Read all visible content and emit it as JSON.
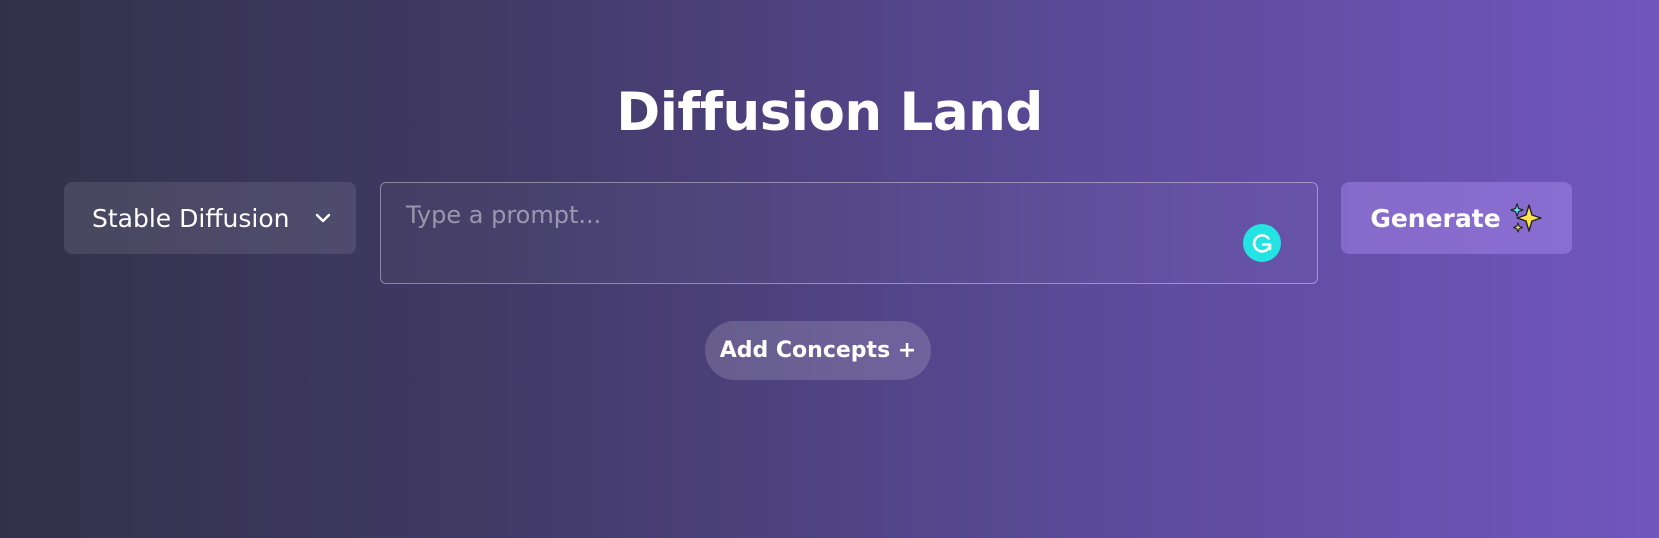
{
  "header": {
    "title": "Diffusion Land"
  },
  "model_select": {
    "selected": "Stable Diffusion",
    "icon": "chevron-down-icon"
  },
  "prompt": {
    "placeholder": "Type a prompt...",
    "value": "",
    "assist_icon": "grammarly-icon",
    "assist_color": "#24e3e3"
  },
  "generate": {
    "label": "Generate",
    "icon": "sparkles-icon"
  },
  "concepts": {
    "label": "Add Concepts +"
  },
  "colors": {
    "background_start": "#33314a",
    "background_end": "#7156be",
    "text": "#ffffff",
    "sparkle_yellow": "#ffe44d",
    "sparkle_cyan": "#5fe2ff"
  }
}
